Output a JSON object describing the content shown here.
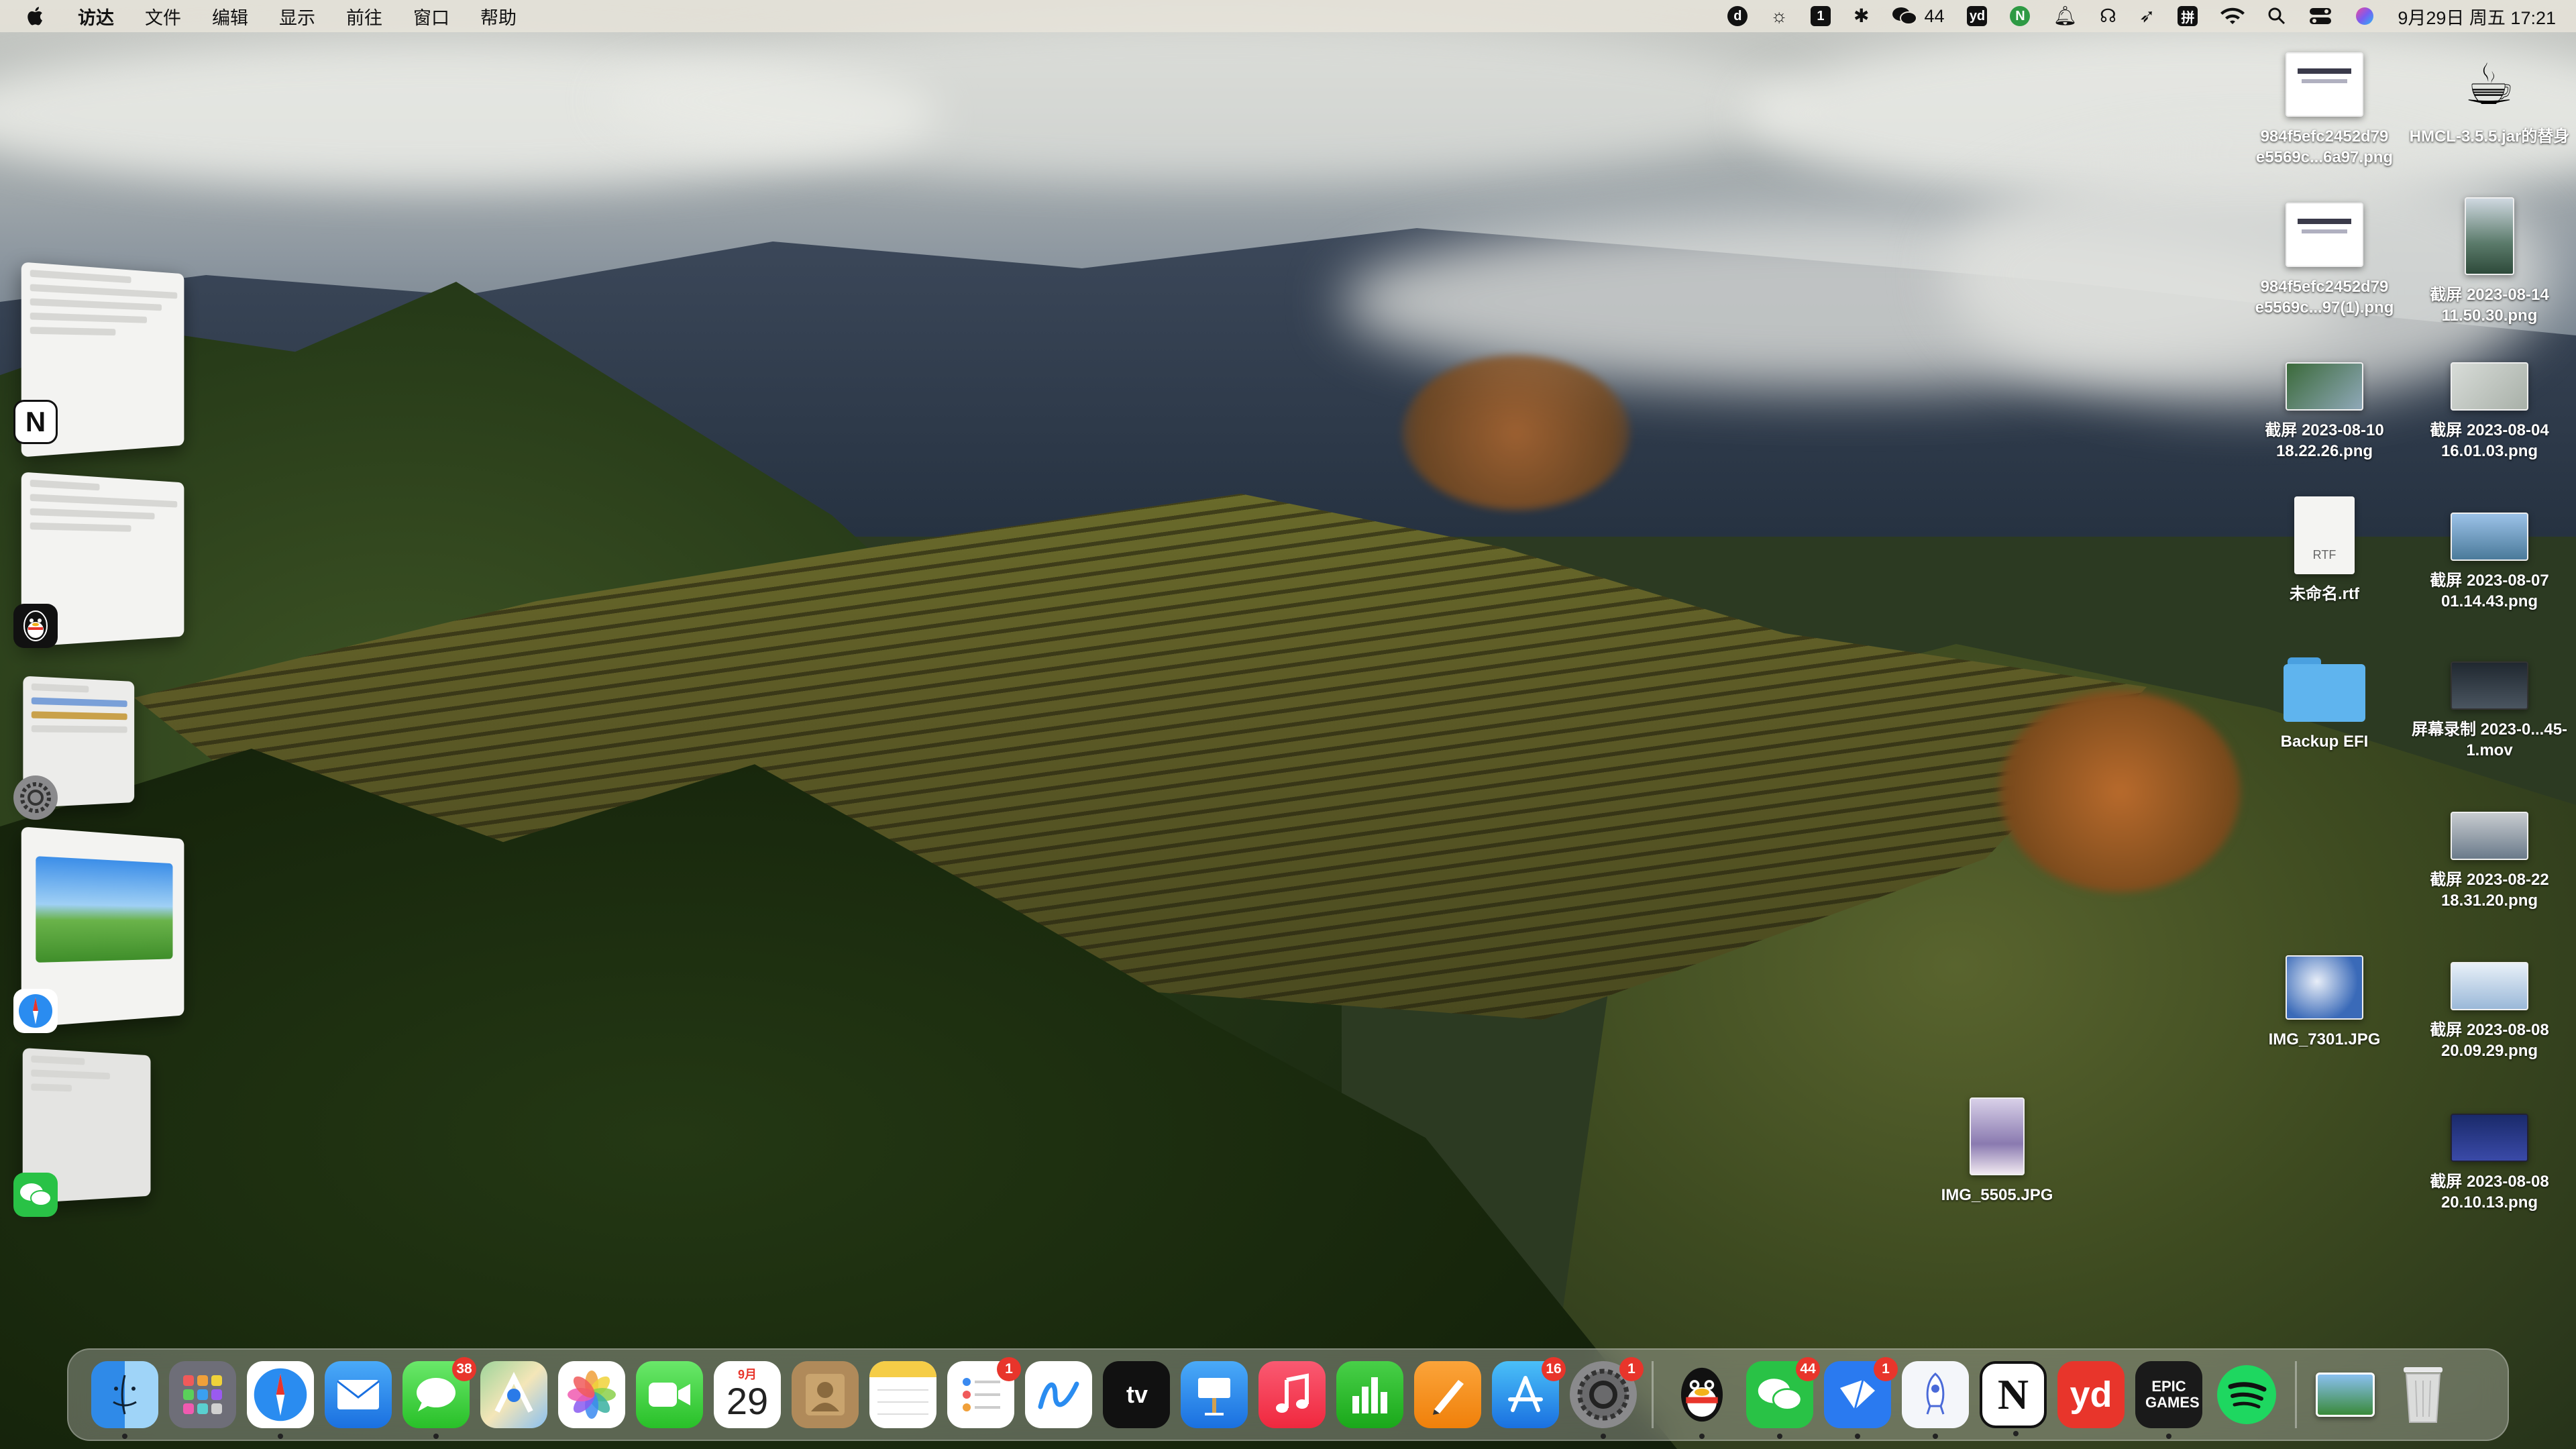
{
  "menubar": {
    "app_name": "访达",
    "menus": [
      "文件",
      "编辑",
      "显示",
      "前往",
      "窗口",
      "帮助"
    ],
    "status": {
      "badge_1": "1",
      "wechat_count": "44",
      "input_method": "拼",
      "datetime": "9月29日 周五 17:21"
    }
  },
  "desktop": {
    "items": [
      {
        "label": "984f5efc2452d79 e5569c...6a97.png"
      },
      {
        "label": "HMCL-3.5.5.jar的替身"
      },
      {
        "label": "984f5efc2452d79 e5569c...97(1).png"
      },
      {
        "label": "截屏 2023-08-14 11.50.30.png"
      },
      {
        "label": "截屏 2023-08-10 18.22.26.png"
      },
      {
        "label": "截屏 2023-08-04 16.01.03.png"
      },
      {
        "label": "未命名.rtf",
        "thumb_text": "RTF"
      },
      {
        "label": "截屏 2023-08-07 01.14.43.png"
      },
      {
        "label": "Backup EFI"
      },
      {
        "label": "屏幕录制 2023-0...45-1.mov"
      },
      {
        "label": "截屏 2023-08-22 18.31.20.png"
      },
      {
        "label": "IMG_7301.JPG"
      },
      {
        "label": "截屏 2023-08-08 20.09.29.png"
      },
      {
        "label": "IMG_5505.JPG"
      },
      {
        "label": "截屏 2023-08-08 20.10.13.png"
      }
    ]
  },
  "stage_manager": {
    "groups": [
      "Notion",
      "QQ",
      "System Settings",
      "Safari",
      "WeChat"
    ]
  },
  "dock": {
    "badges": {
      "messages": "38",
      "reminders": "1",
      "app_store": "16",
      "system_settings": "1",
      "wechat": "44",
      "feishu": "1"
    },
    "calendar": {
      "month": "9月",
      "day": "29"
    },
    "labels": {
      "appletv": "tv",
      "notion": "N",
      "youdao": "yd",
      "epic": "EPIC GAMES"
    }
  },
  "colors": {
    "menubar_bg": "#e8e4da",
    "badge_red": "#e8352b",
    "folder_blue": "#5fb4ee"
  }
}
